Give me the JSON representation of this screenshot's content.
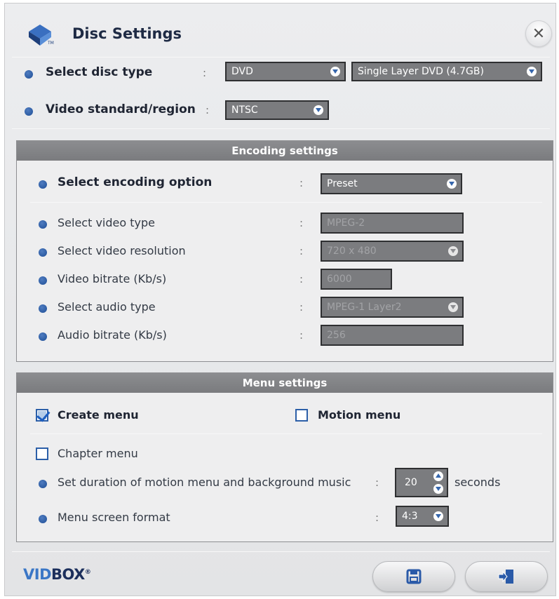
{
  "window": {
    "title": "Disc Settings"
  },
  "disc": {
    "label": "Select disc type",
    "colon": ":",
    "type_value": "DVD",
    "capacity_value": "Single Layer DVD (4.7GB)"
  },
  "region": {
    "label": "Video standard/region",
    "colon": ":",
    "value": "NTSC"
  },
  "encoding": {
    "header": "Encoding settings",
    "option_label": "Select encoding option",
    "option_value": "Preset",
    "rows": [
      {
        "label": "Select video type",
        "value": "MPEG-2"
      },
      {
        "label": "Select video resolution",
        "value": "720 x 480"
      },
      {
        "label": "Video bitrate (Kb/s)",
        "value": "6000"
      },
      {
        "label": "Select audio type",
        "value": "MPEG-1 Layer2"
      },
      {
        "label": "Audio bitrate (Kb/s)",
        "value": "256"
      }
    ],
    "colon": ":"
  },
  "menu": {
    "header": "Menu settings",
    "create_menu_label": "Create menu",
    "create_menu_checked": true,
    "motion_menu_label": "Motion menu",
    "motion_menu_checked": false,
    "chapter_menu_label": "Chapter menu",
    "chapter_menu_checked": false,
    "duration_label": "Set duration of motion menu and background music",
    "duration_value": "20",
    "duration_unit": "seconds",
    "format_label": "Menu screen format",
    "format_value": "4:3",
    "colon": ":"
  },
  "footer": {
    "brand_part1": "VID",
    "brand_part2": "BOX",
    "brand_mark": "®",
    "save_icon": "floppy-disk-icon",
    "exit_icon": "exit-door-icon"
  },
  "colors": {
    "accent": "#3566ad",
    "brand_blue": "#3a76c6",
    "brand_navy": "#1c2f5c",
    "panel_header": "#838487",
    "dropdown_bg": "#7b7c7f"
  }
}
